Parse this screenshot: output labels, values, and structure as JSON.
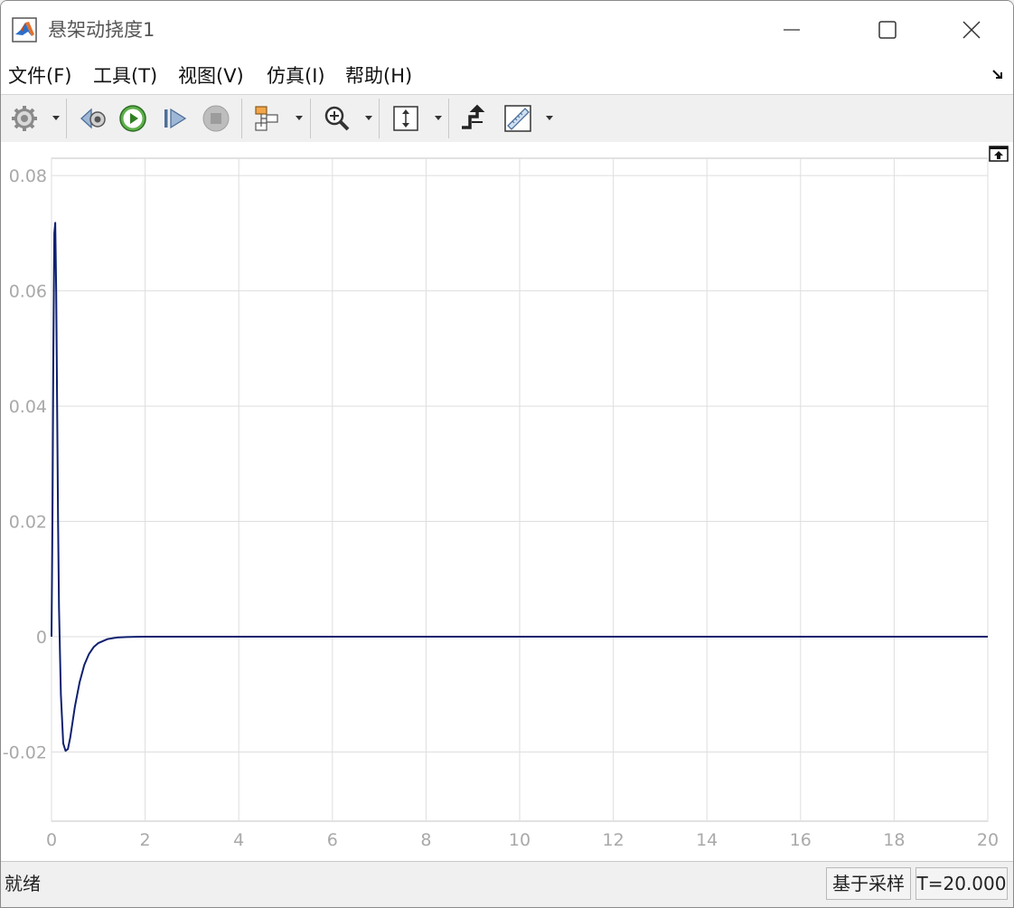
{
  "window": {
    "title": "悬架动挠度1",
    "app_icon": "matlab-icon",
    "controls": [
      "minimize-icon",
      "maximize-icon",
      "close-icon"
    ]
  },
  "menu": {
    "items": [
      {
        "label": "文件(F)"
      },
      {
        "label": "工具(T)"
      },
      {
        "label": "视图(V)"
      },
      {
        "label": "仿真(I)"
      },
      {
        "label": "帮助(H)"
      }
    ],
    "overflow_icon": "arrow-down-right-icon"
  },
  "toolbar": {
    "icons": [
      "settings-gear-icon",
      "step-back-icon",
      "run-icon",
      "step-forward-icon",
      "stop-icon",
      "signal-highlight-icon",
      "zoom-icon",
      "autoscale-icon",
      "triggers-icon",
      "cursor-measurements-icon"
    ]
  },
  "chart_data": {
    "type": "line",
    "title": "",
    "xlabel": "",
    "ylabel": "",
    "xlim": [
      0,
      20
    ],
    "ylim": [
      -0.032,
      0.083
    ],
    "x_ticks": [
      "0",
      "2",
      "4",
      "6",
      "8",
      "10",
      "12",
      "14",
      "16",
      "18",
      "20"
    ],
    "y_ticks": [
      "-0.02",
      "0",
      "0.02",
      "0.04",
      "0.06",
      "0.08"
    ],
    "grid": true,
    "series": [
      {
        "color": "#0f2070",
        "x": [
          0,
          0.02,
          0.04,
          0.06,
          0.08,
          0.1,
          0.12,
          0.14,
          0.16,
          0.2,
          0.25,
          0.3,
          0.35,
          0.4,
          0.45,
          0.5,
          0.6,
          0.7,
          0.8,
          0.9,
          1.0,
          1.2,
          1.4,
          1.6,
          1.8,
          2.0,
          2.5,
          3,
          4,
          6,
          10,
          15,
          20
        ],
        "y": [
          0,
          0.02,
          0.05,
          0.07,
          0.0718,
          0.06,
          0.04,
          0.02,
          0.005,
          -0.01,
          -0.0185,
          -0.0198,
          -0.0195,
          -0.0175,
          -0.0148,
          -0.0121,
          -0.0079,
          -0.0049,
          -0.003,
          -0.0018,
          -0.0011,
          -0.0004,
          -0.00014,
          -5e-05,
          -2e-05,
          0,
          0,
          0,
          0,
          0,
          0,
          0,
          0
        ]
      }
    ]
  },
  "status": {
    "text": "就绪",
    "sample_mode": "基于采样",
    "time": "T=20.000"
  }
}
